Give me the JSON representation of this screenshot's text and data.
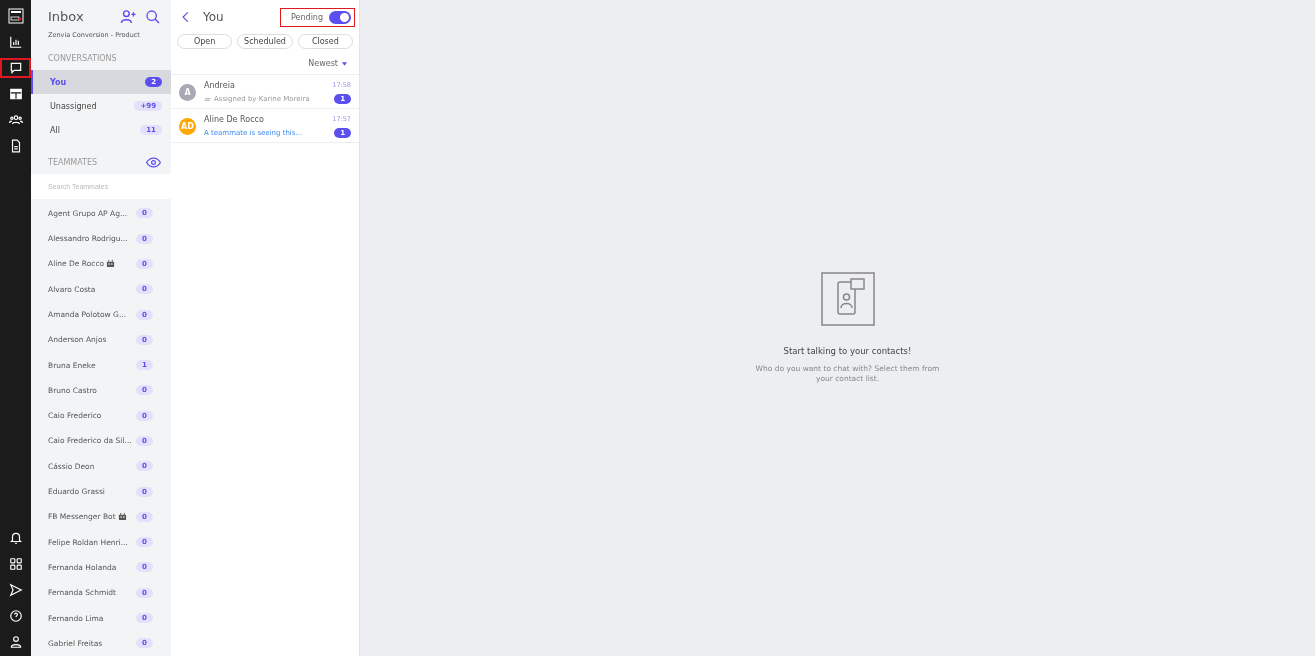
{
  "nav": {
    "top": [
      {
        "kind": "logo",
        "highlighted": false
      },
      {
        "kind": "chart",
        "highlighted": false
      },
      {
        "kind": "chat",
        "highlighted": true
      },
      {
        "kind": "table",
        "highlighted": false
      },
      {
        "kind": "team",
        "highlighted": false
      },
      {
        "kind": "doc",
        "highlighted": false
      }
    ],
    "bottom": [
      {
        "kind": "bell"
      },
      {
        "kind": "grid"
      },
      {
        "kind": "send"
      },
      {
        "kind": "help"
      },
      {
        "kind": "user"
      }
    ]
  },
  "inbox": {
    "title": "Inbox",
    "subtitle": "Zenvia Conversion - Product",
    "conversations_heading": "CONVERSATIONS",
    "conversations": [
      {
        "label": "You",
        "count": "2",
        "selected": true
      },
      {
        "label": "Unassigned",
        "count": "+99",
        "selected": false
      },
      {
        "label": "All",
        "count": "11",
        "selected": false
      }
    ],
    "teammates_heading": "TEAMMATES",
    "search": {
      "placeholder": "Search Teammates"
    },
    "teammates": [
      {
        "name": "Agent Grupo AP Ag...",
        "count": "0",
        "bot": false
      },
      {
        "name": "Alessandro Rodrigu...",
        "count": "0",
        "bot": false
      },
      {
        "name": "Aline De Rocco",
        "count": "0",
        "bot": true
      },
      {
        "name": "Alvaro Costa",
        "count": "0",
        "bot": false
      },
      {
        "name": "Amanda Polotow G...",
        "count": "0",
        "bot": false
      },
      {
        "name": "Anderson Anjos",
        "count": "0",
        "bot": false
      },
      {
        "name": "Bruna Eneke",
        "count": "1",
        "bot": false
      },
      {
        "name": "Bruno Castro",
        "count": "0",
        "bot": false
      },
      {
        "name": "Caio Frederico",
        "count": "0",
        "bot": false
      },
      {
        "name": "Caio Frederico da Sil...",
        "count": "0",
        "bot": false
      },
      {
        "name": "Cássio Deon",
        "count": "0",
        "bot": false
      },
      {
        "name": "Eduardo Grassi",
        "count": "0",
        "bot": false
      },
      {
        "name": "FB Messenger Bot",
        "count": "0",
        "bot": true
      },
      {
        "name": "Felipe Roldan Henri...",
        "count": "0",
        "bot": false
      },
      {
        "name": "Fernanda Holanda",
        "count": "0",
        "bot": false
      },
      {
        "name": "Fernanda Schmidt",
        "count": "0",
        "bot": false
      },
      {
        "name": "Fernando Lima",
        "count": "0",
        "bot": false
      },
      {
        "name": "Gabriel Freitas",
        "count": "0",
        "bot": false
      }
    ]
  },
  "list": {
    "title": "You",
    "pending": {
      "label": "Pending",
      "on": true,
      "highlighted": true
    },
    "filters": [
      {
        "label": "Open"
      },
      {
        "label": "Scheduled"
      },
      {
        "label": "Closed"
      }
    ],
    "sort": "Newest",
    "items": [
      {
        "avatar": "A",
        "color": "#a9a9b3",
        "name": "Andreia",
        "time": "17:58",
        "detail": "Assigned by Karine Moreira",
        "kind": "assigned",
        "count": "1"
      },
      {
        "avatar": "AD",
        "color": "#ffa800",
        "name": "Aline De Rocco",
        "time": "17:57",
        "detail": "A teammate is seeing this...",
        "kind": "typing",
        "count": "1"
      }
    ]
  },
  "empty": {
    "title": "Start talking to your contacts!",
    "text": "Who do you want to chat with? Select them from your contact list."
  }
}
